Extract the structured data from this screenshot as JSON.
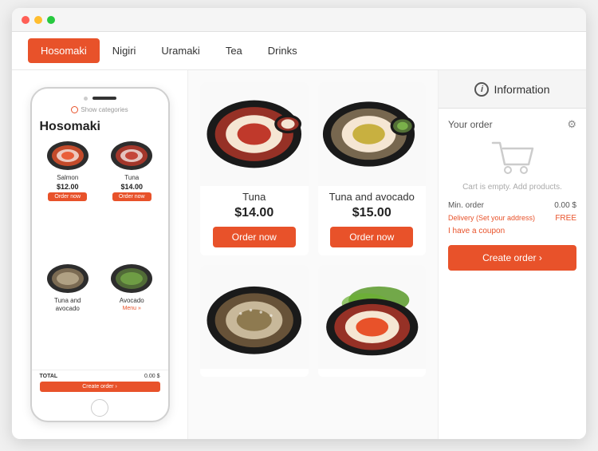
{
  "browser": {
    "dots": [
      "red",
      "yellow",
      "green"
    ]
  },
  "nav": {
    "tabs": [
      {
        "label": "Hosomaki",
        "active": true
      },
      {
        "label": "Nigiri",
        "active": false
      },
      {
        "label": "Uramaki",
        "active": false
      },
      {
        "label": "Tea",
        "active": false
      },
      {
        "label": "Drinks",
        "active": false
      }
    ]
  },
  "phone": {
    "show_categories": "Show categories",
    "title": "Hosomaki",
    "products": [
      {
        "name": "Salmon",
        "price": "$12.00",
        "btn": "Order now"
      },
      {
        "name": "Tuna",
        "price": "$14.00",
        "btn": "Order now"
      },
      {
        "name": "Tuna and avocado",
        "price": "",
        "btn": ""
      },
      {
        "name": "Avocado",
        "price": "",
        "btn": ""
      }
    ],
    "menu_label": "Menu »",
    "total_label": "TOTAL",
    "total_amount": "0.00 $",
    "create_btn": "Create order ›"
  },
  "grid": {
    "products": [
      {
        "name": "Tuna",
        "price": "$14.00",
        "btn": "Order now"
      },
      {
        "name": "Tuna and avocado",
        "price": "$15.00",
        "btn": "Order now"
      },
      {
        "name": "",
        "price": "",
        "btn": ""
      },
      {
        "name": "",
        "price": "",
        "btn": ""
      }
    ]
  },
  "info": {
    "icon": "i",
    "title": "Information",
    "your_order": "Your order",
    "cart_empty": "Cart is empty. Add products.",
    "min_order_label": "Min. order",
    "min_order_value": "0.00 $",
    "delivery_label": "Delivery (Set your address)",
    "delivery_value": "FREE",
    "coupon": "I have a coupon",
    "create_order_btn": "Create order ›"
  }
}
